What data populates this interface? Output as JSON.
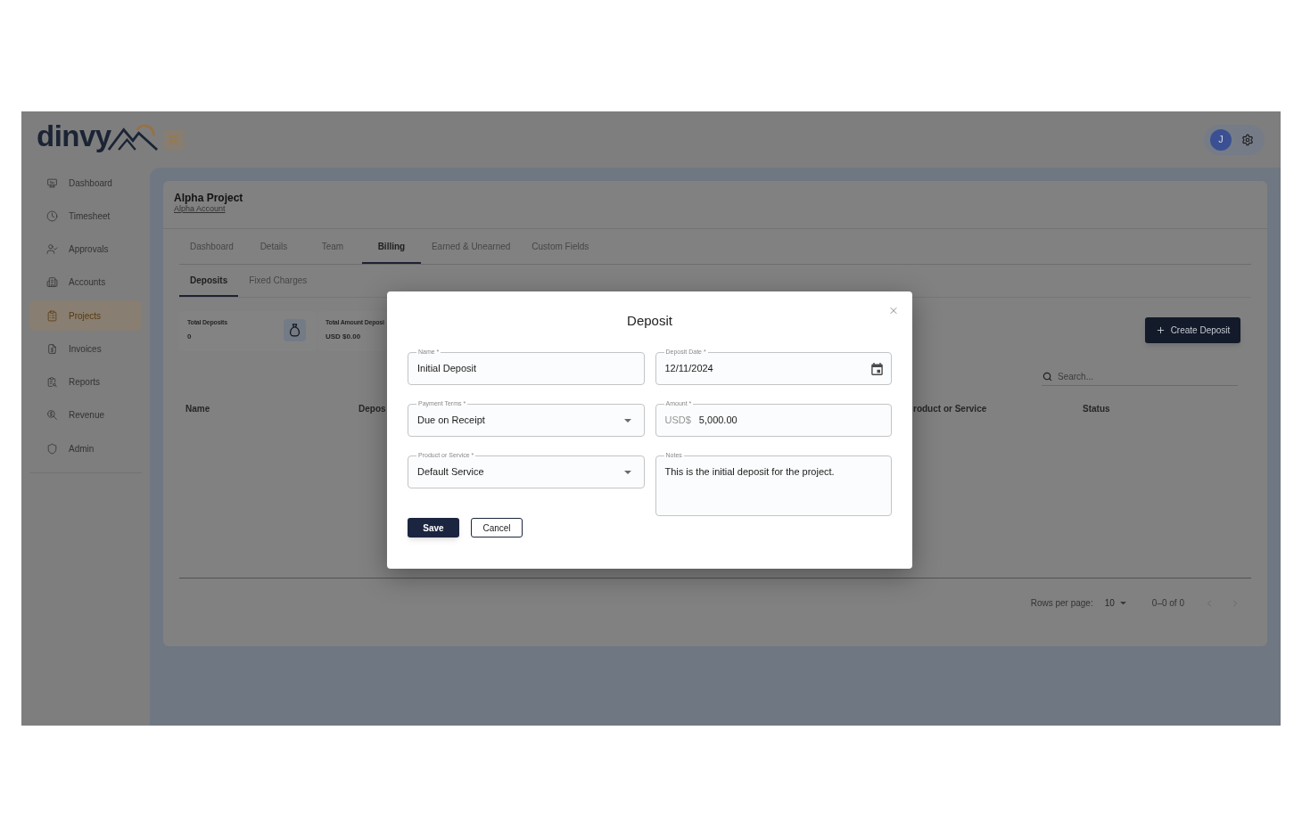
{
  "header": {
    "logo": "dinvy",
    "avatar": "J"
  },
  "sidebar": {
    "items": [
      {
        "label": "Dashboard",
        "selected": false
      },
      {
        "label": "Timesheet",
        "selected": false
      },
      {
        "label": "Approvals",
        "selected": false
      },
      {
        "label": "Accounts",
        "selected": false
      },
      {
        "label": "Projects",
        "selected": true
      },
      {
        "label": "Invoices",
        "selected": false
      },
      {
        "label": "Reports",
        "selected": false
      },
      {
        "label": "Revenue",
        "selected": false
      },
      {
        "label": "Admin",
        "selected": false
      }
    ]
  },
  "project": {
    "title": "Alpha Project",
    "account": "Alpha Account"
  },
  "tabs": [
    {
      "label": "Dashboard",
      "selected": false
    },
    {
      "label": "Details",
      "selected": false
    },
    {
      "label": "Team",
      "selected": false
    },
    {
      "label": "Billing",
      "selected": true
    },
    {
      "label": "Earned & Unearned",
      "selected": false
    },
    {
      "label": "Custom Fields",
      "selected": false
    }
  ],
  "subtabs": [
    {
      "label": "Deposits",
      "selected": true
    },
    {
      "label": "Fixed Charges",
      "selected": false
    }
  ],
  "stats": [
    {
      "label": "Total Deposits",
      "value": "0"
    },
    {
      "label": "Total Amount Deposi",
      "value": "USD $0.00"
    }
  ],
  "create_button": {
    "label": "Create Deposit"
  },
  "search": {
    "placeholder": "Search..."
  },
  "table": {
    "columns": [
      "Name",
      "Depos",
      "roduct or Service",
      "Status"
    ]
  },
  "pagination": {
    "rows_label": "Rows per page:",
    "rows_value": "10",
    "range": "0–0 of 0",
    "buttons": [
      {
        "kind": "prev",
        "disabled": true
      },
      {
        "kind": "next",
        "disabled": true
      }
    ]
  },
  "dialog": {
    "title": "Deposit",
    "fields": [
      {
        "kind": "text",
        "label": "Name *",
        "value": "Initial Deposit"
      },
      {
        "kind": "date",
        "label": "Deposit Date *",
        "value": "12/11/2024"
      },
      {
        "kind": "select",
        "label": "Payment Terms *",
        "value": "Due on Receipt"
      },
      {
        "kind": "currency",
        "label": "Amount *",
        "prefix": "USD$",
        "value": "5,000.00"
      },
      {
        "kind": "select",
        "label": "Product or Service *",
        "value": "Default Service"
      },
      {
        "kind": "textarea",
        "label": "Notes",
        "value": "This is the initial deposit for the project."
      }
    ],
    "buttons": [
      {
        "kind": "primary",
        "label": "Save"
      },
      {
        "kind": "secondary",
        "label": "Cancel"
      }
    ]
  }
}
